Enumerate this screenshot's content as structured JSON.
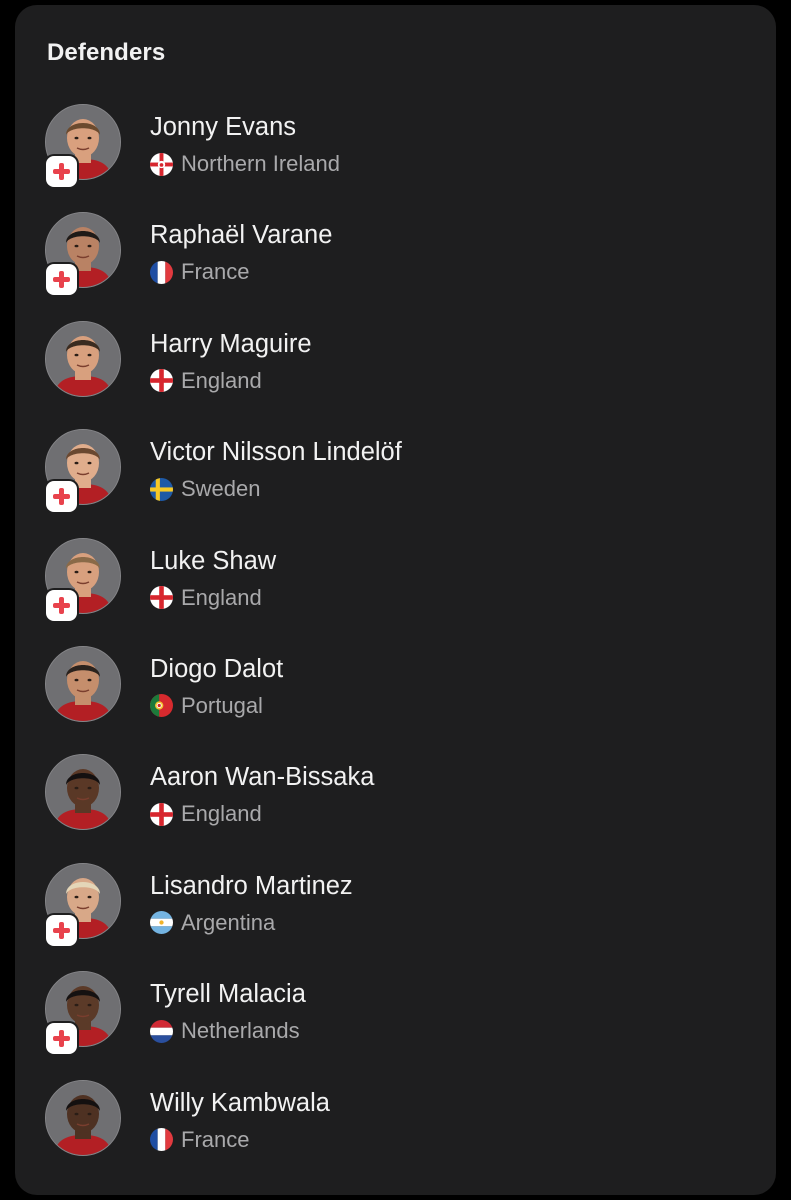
{
  "section": {
    "title": "Defenders"
  },
  "players": [
    {
      "name": "Jonny Evans",
      "nation": "Northern Ireland",
      "flag_icon": "northern-ireland-flag-icon",
      "injured": true,
      "skin": "#d9a07e",
      "hair": "#6b4a2e"
    },
    {
      "name": "Raphaël Varane",
      "nation": "France",
      "flag_icon": "france-flag-icon",
      "injured": true,
      "skin": "#b98264",
      "hair": "#1f1a17"
    },
    {
      "name": "Harry Maguire",
      "nation": "England",
      "flag_icon": "england-flag-icon",
      "injured": false,
      "skin": "#d8a07e",
      "hair": "#3a2b20"
    },
    {
      "name": "Victor Nilsson Lindelöf",
      "nation": "Sweden",
      "flag_icon": "sweden-flag-icon",
      "injured": true,
      "skin": "#e0ad8c",
      "hair": "#6a4830"
    },
    {
      "name": "Luke Shaw",
      "nation": "England",
      "flag_icon": "england-flag-icon",
      "injured": true,
      "skin": "#d8a07e",
      "hair": "#8a6a48"
    },
    {
      "name": "Diogo Dalot",
      "nation": "Portugal",
      "flag_icon": "portugal-flag-icon",
      "injured": false,
      "skin": "#c58e6c",
      "hair": "#2a221d"
    },
    {
      "name": "Aaron Wan-Bissaka",
      "nation": "England",
      "flag_icon": "england-flag-icon",
      "injured": false,
      "skin": "#5a3826",
      "hair": "#141010"
    },
    {
      "name": "Lisandro Martinez",
      "nation": "Argentina",
      "flag_icon": "argentina-flag-icon",
      "injured": true,
      "skin": "#d8a888",
      "hair": "#e4d6b8"
    },
    {
      "name": "Tyrell Malacia",
      "nation": "Netherlands",
      "flag_icon": "netherlands-flag-icon",
      "injured": true,
      "skin": "#5b3a28",
      "hair": "#151111"
    },
    {
      "name": "Willy Kambwala",
      "nation": "France",
      "flag_icon": "france-flag-icon",
      "injured": false,
      "skin": "#4e3122",
      "hair": "#141010"
    }
  ],
  "icons": {
    "injury": "injury-cross-icon"
  },
  "colors": {
    "card_background": "#1e1e1f",
    "page_background": "#000000",
    "title_text": "#f2f2f2",
    "secondary_text": "#a9a9ab",
    "injury_cross": "#e8424c",
    "avatar_background": "#6f6f72"
  }
}
